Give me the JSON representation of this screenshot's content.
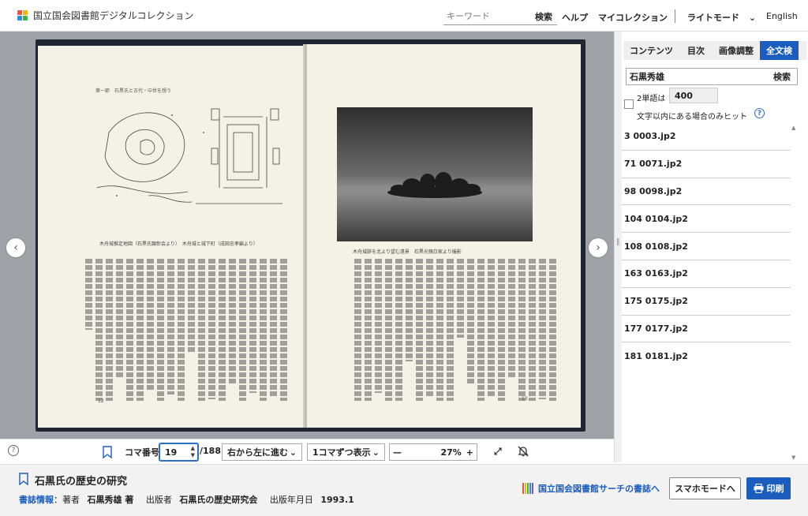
{
  "header": {
    "site_title": "国立国会図書館デジタルコレクション",
    "search_placeholder": "キーワード",
    "search_button": "検索",
    "nav": [
      "ヘルプ",
      "マイコレクション"
    ],
    "theme_label": "ライトモード",
    "language": "English"
  },
  "right_panel": {
    "tabs": [
      "コンテンツ",
      "目次",
      "画像調整",
      "全文検"
    ],
    "active_tab": 3,
    "search_value": "石黒秀雄",
    "search_button": "検索",
    "option_prefix": "2単語は",
    "option_value": "400",
    "option_suffix": "文字以内にある場合のみヒット",
    "results": [
      "3 0003.jp2",
      "71 0071.jp2",
      "98 0098.jp2",
      "104 0104.jp2",
      "108 0108.jp2",
      "163 0163.jp2",
      "175 0175.jp2",
      "177 0177.jp2",
      "181 0181.jp2"
    ]
  },
  "toolbar": {
    "page_label": "コマ番号",
    "page_value": "19",
    "page_total": "/188",
    "direction": "右から左に進む",
    "display_mode": "1コマずつ表示",
    "zoom_minus": "—",
    "zoom_value": "27",
    "zoom_unit": "%",
    "zoom_plus": "+"
  },
  "book_page": {
    "left_running_head": "第一節　石黒氏と古代・中世を想う",
    "left_caption": "木舟城推定地図（石黒氏顕彰会より）　木舟城と城下町（成田忠孝編より）",
    "right_caption": "木舟城跡を北より望む遠景　石黒光親白家より撮影",
    "left_pageno": "12",
    "right_pageno": "13"
  },
  "footer": {
    "title": "石黒氏の歴史の研究",
    "meta_link": "書誌情報",
    "author_label": "：著者",
    "author": "石黒秀雄 著",
    "publisher_label": "出版者",
    "publisher": "石黒氏の歴史研究会",
    "date_label": "出版年月日",
    "date": "1993.1",
    "ndl_link": "国立国会図書館サーチの書誌へ",
    "mode_button": "スマホモードへ",
    "print_button": "印刷"
  },
  "colors": {
    "accent": "#1a5dbf",
    "viewer_bg": "#9fa3a8"
  }
}
